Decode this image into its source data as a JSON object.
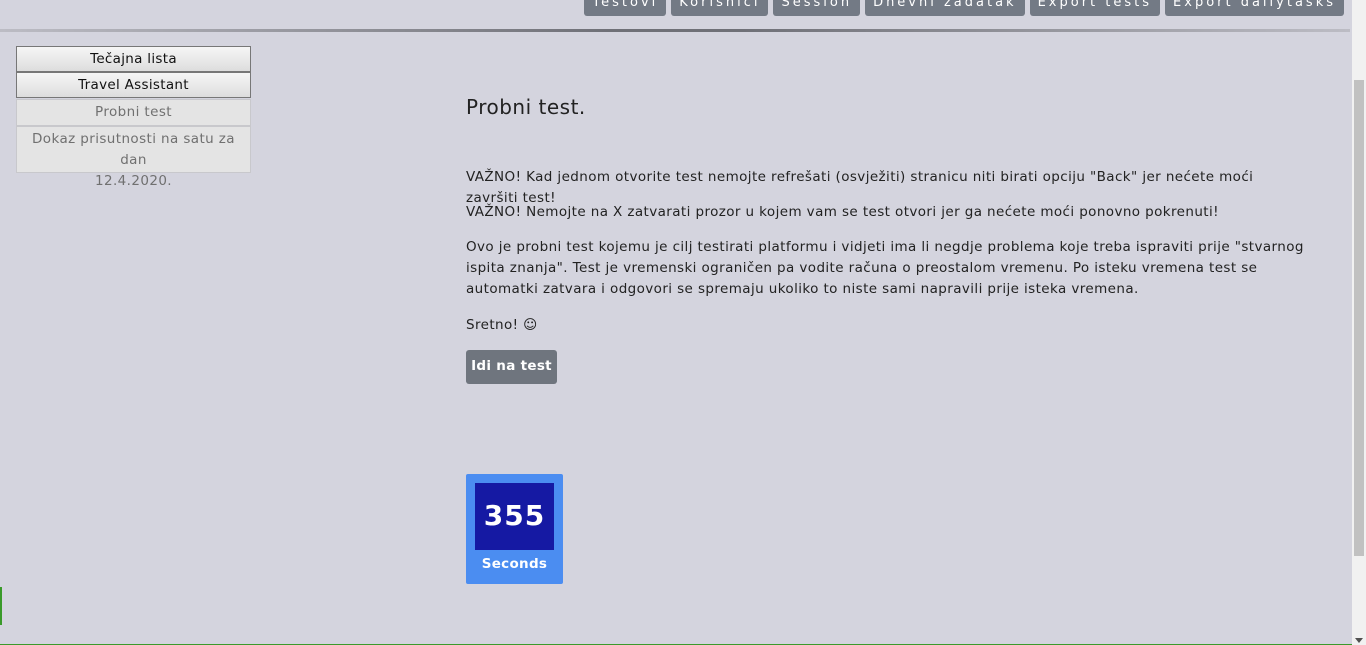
{
  "topnav": {
    "items": [
      "Testovi",
      "Korisnici",
      "Session",
      "Dnevni zadatak",
      "Export tests",
      "Export dailytasks"
    ]
  },
  "sidebar": {
    "btn_tecajna": "Tečajna lista",
    "btn_travel": "Travel Assistant",
    "item_probni": "Probni test",
    "item_dokaz_line1": "Dokaz prisutnosti na satu za dan",
    "item_dokaz_line2": "12.4.2020."
  },
  "main": {
    "title": "Probni test.",
    "warning1": "VAŽNO! Kad jednom otvorite test nemojte refrešati (osvježiti) stranicu niti birati opciju \"Back\" jer nećete moći završiti test!",
    "warning2": "VAŽNO! Nemojte na X zatvarati prozor u kojem vam se test otvori jer ga nećete moći ponovno pokrenuti!",
    "info": "Ovo je probni test kojemu je cilj testirati platformu i vidjeti ima li negdje problema koje treba ispraviti prije \"stvarnog ispita znanja\". Test je vremenski ograničen pa vodite računa o preostalom vremenu. Po isteku vremena test se automatki zatvara i odgovori se spremaju ukoliko to niste sami napravili prije isteka vremena.",
    "luck": "Sretno! ☺",
    "go_button": "Idi na test"
  },
  "timer": {
    "value": "355",
    "label": "Seconds"
  },
  "colors": {
    "background": "#d4d4de",
    "nav_button": "#737a85",
    "go_button": "#6f757e",
    "timer_outer": "#4b8df1",
    "timer_inner": "#1519a3"
  }
}
